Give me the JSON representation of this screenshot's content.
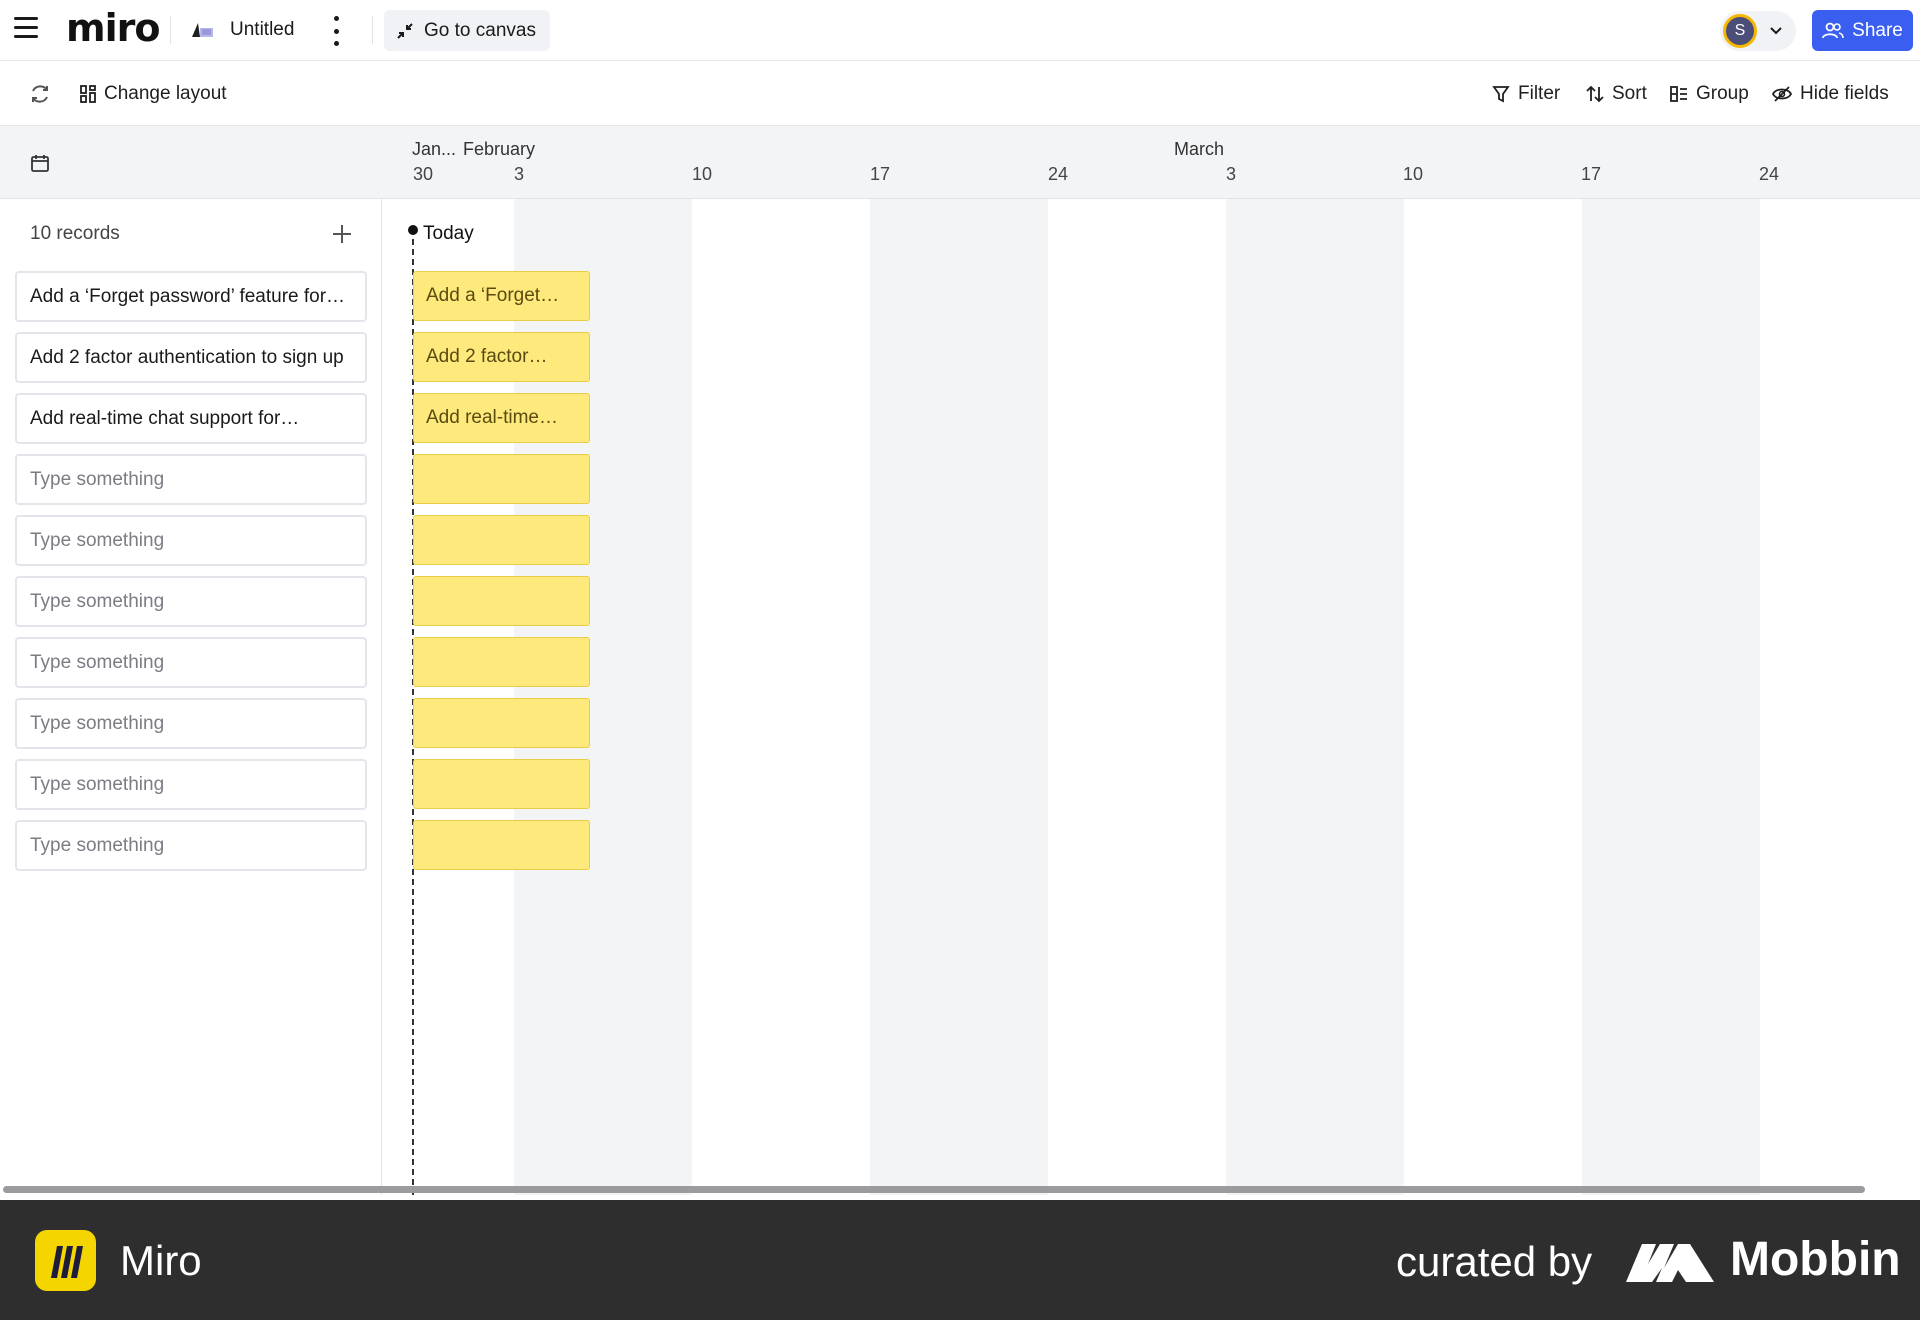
{
  "topbar": {
    "logo": "miro",
    "board_title": "Untitled",
    "goto_label": "Go to canvas",
    "avatar_initial": "S",
    "share_label": "Share"
  },
  "toolbar": {
    "change_layout": "Change layout",
    "filter": "Filter",
    "sort": "Sort",
    "group": "Group",
    "hide_fields": "Hide fields"
  },
  "timeline": {
    "months": [
      "Jan...",
      "February",
      "March"
    ],
    "days": [
      "30",
      "3",
      "10",
      "17",
      "24",
      "3",
      "10",
      "17",
      "24"
    ],
    "today_label": "Today"
  },
  "records": {
    "count_label": "10 records",
    "placeholder": "Type something",
    "items": [
      "Add a ‘Forget password’ feature for…",
      "Add 2 factor authentication to sign up",
      "Add real-time chat support for…",
      "",
      "",
      "",
      "",
      "",
      "",
      ""
    ]
  },
  "bars": [
    "Add a ‘Forget…",
    "Add 2 factor…",
    "Add real-time…",
    "",
    "",
    "",
    "",
    "",
    "",
    ""
  ],
  "footer": {
    "app_name": "Miro",
    "curated_by": "curated by",
    "brand": "Mobbin"
  },
  "colors": {
    "accent": "#3a5ef0",
    "bar_fill": "#fde97c",
    "bar_border": "#e9cd46",
    "week_band": "#f3f4f6",
    "footer_bg": "#2e2e2e"
  }
}
